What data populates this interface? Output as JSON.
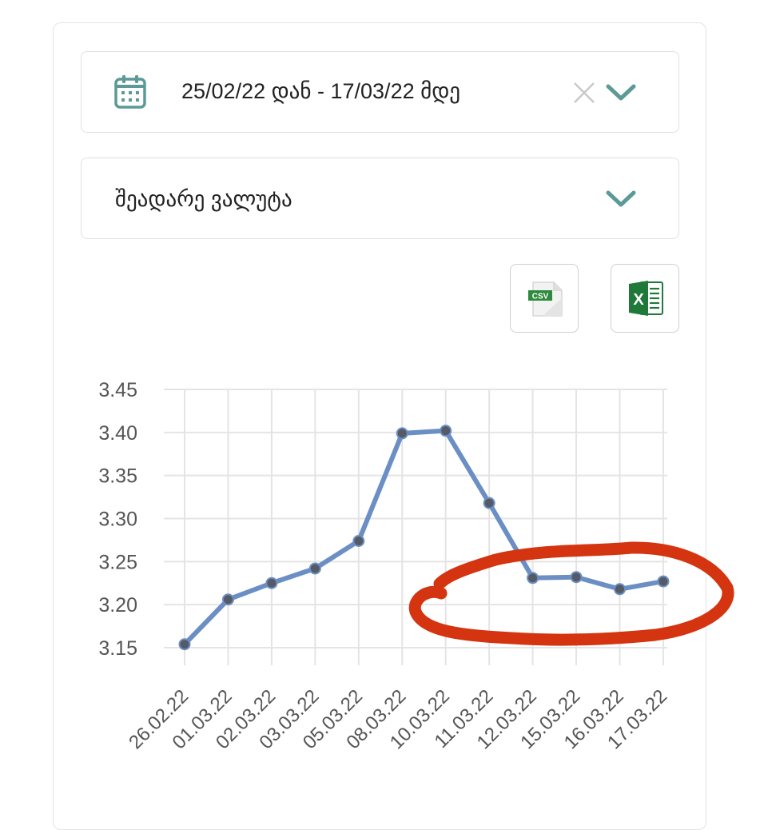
{
  "date_filter": {
    "value": "25/02/22 დან - 17/03/22 მდე",
    "icon": "calendar-icon",
    "clear_icon": "close-icon",
    "toggle_icon": "chevron-down-icon"
  },
  "compare_filter": {
    "placeholder": "შეადარე ვალუტა",
    "toggle_icon": "chevron-down-icon"
  },
  "export": {
    "csv_label": "CSV",
    "xls_label": "X"
  },
  "colors": {
    "accent": "#5b9a96",
    "line": "#6b8fc4",
    "marker": "#555a66",
    "annotation": "#d4340f",
    "grid": "#e4e4e4"
  },
  "chart_data": {
    "type": "line",
    "categories": [
      "26.02.22",
      "01.03.22",
      "02.03.22",
      "03.03.22",
      "05.03.22",
      "08.03.22",
      "10.03.22",
      "11.03.22",
      "12.03.22",
      "15.03.22",
      "16.03.22",
      "17.03.22"
    ],
    "values": [
      3.154,
      3.206,
      3.225,
      3.242,
      3.274,
      3.399,
      3.402,
      3.318,
      3.231,
      3.232,
      3.218,
      3.227
    ],
    "ylim": [
      3.15,
      3.45
    ],
    "yticks": [
      "3.45",
      "3.40",
      "3.35",
      "3.30",
      "3.25",
      "3.20",
      "3.15"
    ],
    "grid": true,
    "annotation": "hand-drawn red circle around last five points"
  }
}
